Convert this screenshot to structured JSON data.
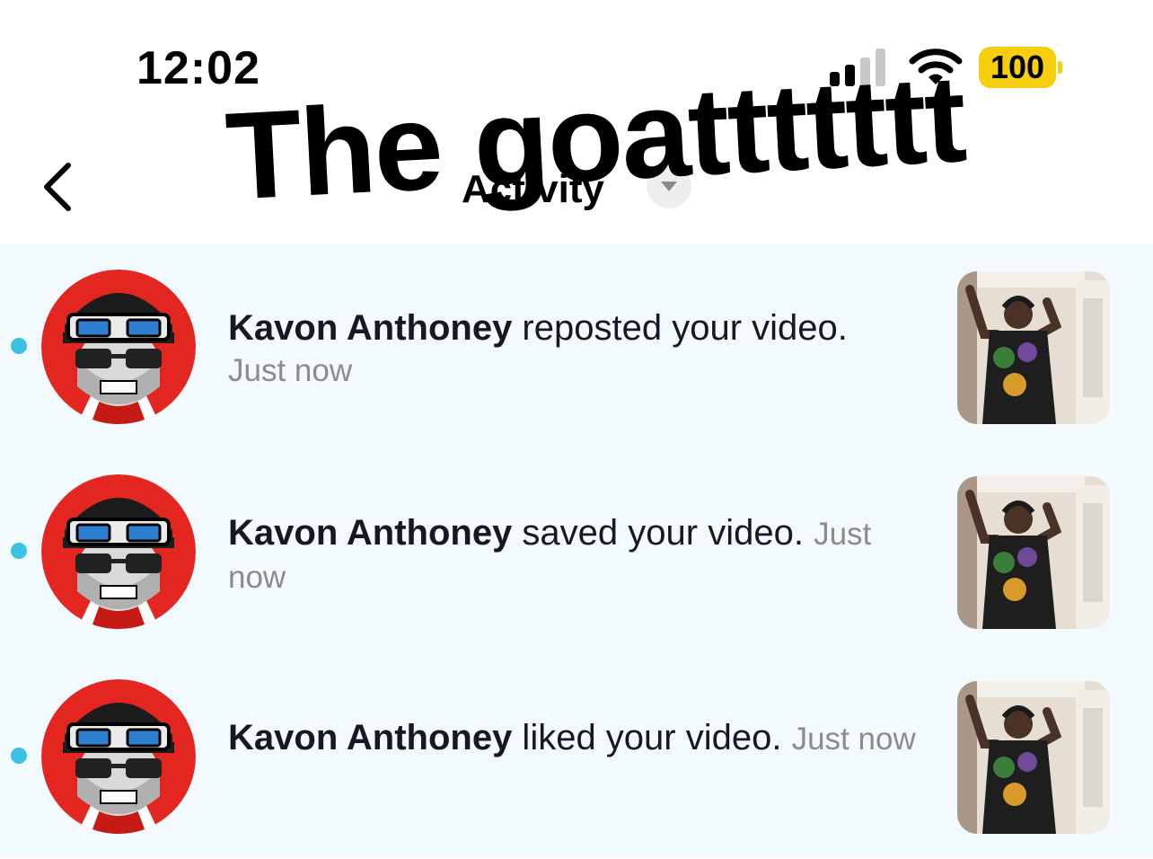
{
  "status_bar": {
    "time": "12:02",
    "battery": "100",
    "signal_icon": "cellular-signal-icon",
    "wifi_icon": "wifi-icon"
  },
  "header": {
    "title": "Activity",
    "back_icon": "chevron-left-icon",
    "dropdown_icon": "caret-down-icon"
  },
  "overlay_caption": "The goattttttt",
  "notifications": [
    {
      "name": "Kavon Anthoney",
      "action": " reposted your video.",
      "time": "Just now",
      "unread": true
    },
    {
      "name": "Kavon Anthoney",
      "action": " saved your video.",
      "time": "Just now",
      "unread": true
    },
    {
      "name": "Kavon Anthoney",
      "action": " liked your video.",
      "time": "Just now",
      "unread": true
    }
  ],
  "colors": {
    "unread_dot": "#3bc2e3",
    "list_background": "#f3fafe",
    "battery": "#f7ce0e",
    "secondary_text": "#8a8b91"
  }
}
